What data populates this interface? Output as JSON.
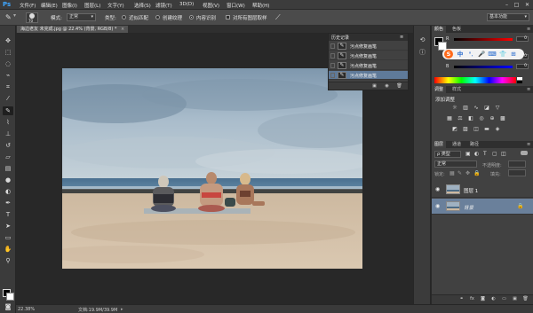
{
  "app": {
    "logo": "Ps"
  },
  "menubar": {
    "items": [
      "文件(F)",
      "编辑(E)",
      "图像(I)",
      "图层(L)",
      "文字(Y)",
      "选择(S)",
      "滤镜(T)",
      "3D(D)",
      "视图(V)",
      "窗口(W)",
      "帮助(H)"
    ],
    "window_controls": [
      "–",
      "□",
      "✕"
    ]
  },
  "options_bar": {
    "brush_size": "70",
    "mode_label": "模式:",
    "mode_value": "正常",
    "type_label": "类型:",
    "option_proximity": "近似匹配",
    "option_texture": "创建纹理",
    "option_content_aware": "内容识别",
    "option_sample_all": "对所有图层取样",
    "workspace": "基本功能"
  },
  "document": {
    "tab_title": "海边老友 未完成.jpg @ 22.4% (背景, RGB/8) *",
    "zoom": "22.38%",
    "doc_size": "文档:19.9M/39.9M"
  },
  "history_panel": {
    "title": "历史记录",
    "entries": [
      "污点修复画笔",
      "污点修复画笔",
      "污点修复画笔",
      "污点修复画笔"
    ],
    "selected_index": 3
  },
  "color_panel": {
    "tabs": [
      "颜色",
      "色板"
    ],
    "sliders": [
      {
        "label": "R",
        "value": "0",
        "color": "#ff0000"
      },
      {
        "label": "G",
        "value": "0",
        "color": "#00ff00"
      },
      {
        "label": "B",
        "value": "0",
        "color": "#0000ff"
      }
    ],
    "ime_items": [
      "S",
      "中",
      "°,",
      "🎤",
      "⌨",
      "👕",
      "⊞"
    ]
  },
  "adjustments_panel": {
    "tabs": [
      "调整",
      "样式"
    ],
    "heading": "添加调整"
  },
  "layers_panel": {
    "tabs": [
      "图层",
      "通道",
      "路径"
    ],
    "filter_kind": "ρ 类型",
    "blend_mode": "正常",
    "opacity_label": "不透明度:",
    "lock_label": "锁定:",
    "fill_label": "填充:",
    "layers": [
      {
        "name": "图层 1",
        "italic": false,
        "locked": false,
        "selected": false
      },
      {
        "name": "背景",
        "italic": true,
        "locked": true,
        "selected": true
      }
    ]
  }
}
